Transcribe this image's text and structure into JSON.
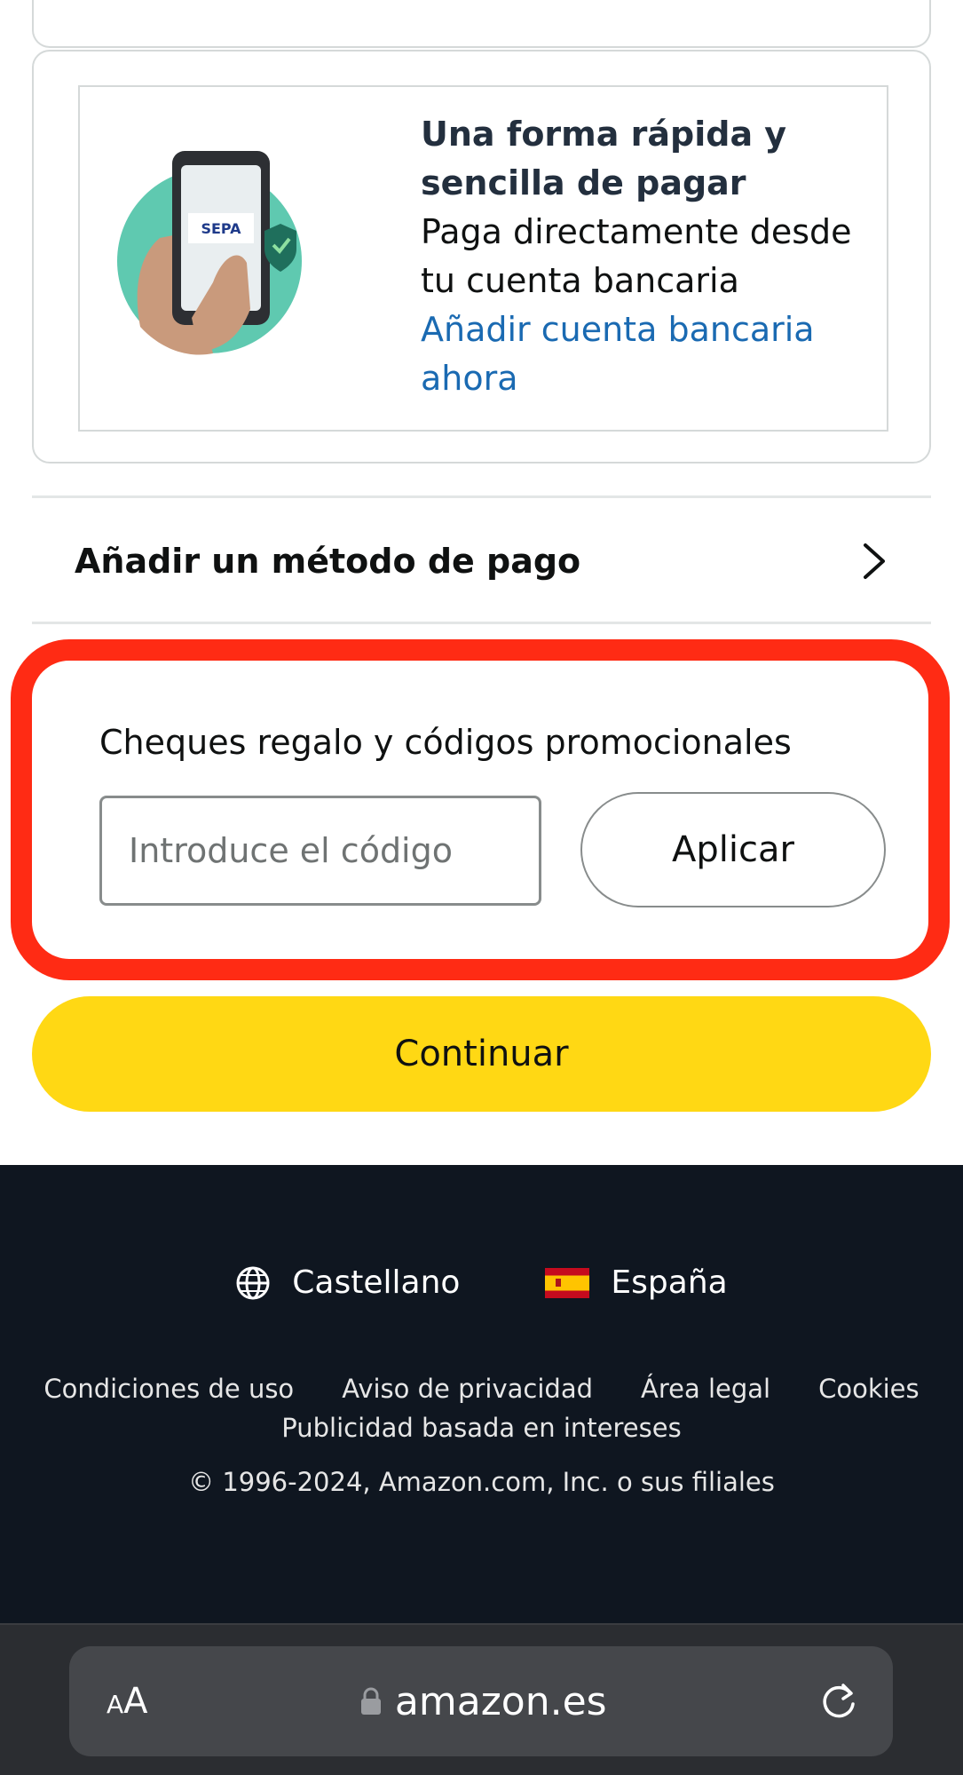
{
  "sepa_banner": {
    "title": "Una forma rápida y sencilla de pagar",
    "description": "Paga directamente desde tu cuenta bancaria",
    "link": "Añadir cuenta bancaria ahora",
    "illustration_text": "SEPA"
  },
  "payment_method": {
    "label": "Añadir un método de pago"
  },
  "promo": {
    "title": "Cheques regalo y códigos promocionales",
    "input_value": "",
    "input_placeholder": "Introduce el código",
    "apply_label": "Aplicar"
  },
  "continue_label": "Continuar",
  "footer": {
    "language": "Castellano",
    "country": "España",
    "links_row1": [
      "Condiciones de uso",
      "Aviso de privacidad",
      "Área legal",
      "Cookies"
    ],
    "links_row2": "Publicidad basada en intereses",
    "copyright": "© 1996-2024, Amazon.com, Inc. o sus filiales"
  },
  "browser": {
    "text_size_small": "A",
    "text_size_large": "A",
    "url": "amazon.es"
  },
  "colors": {
    "highlight": "#ff2b14",
    "continue_button": "#ffd814",
    "link": "#1a6ab2",
    "footer_bg": "#0f1620"
  }
}
